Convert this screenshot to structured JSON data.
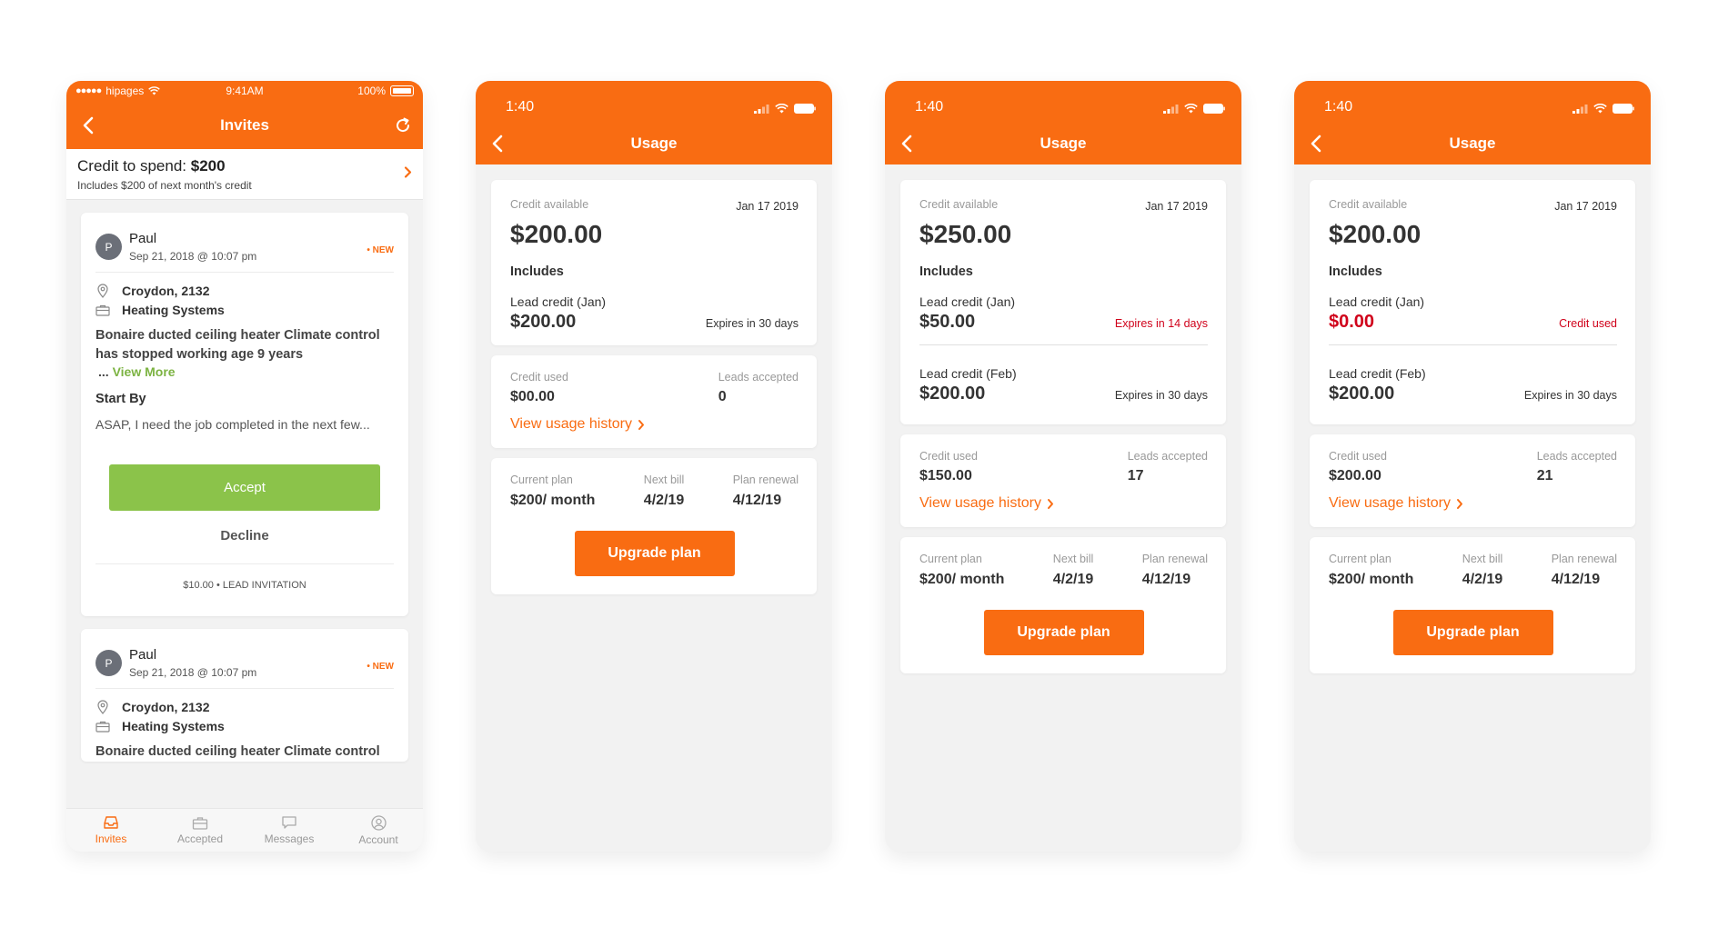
{
  "colors": {
    "accent": "#f96c12",
    "accept_green": "#8bc34a",
    "view_more_green": "#7cb342",
    "alert_red": "#d0021b"
  },
  "invites_screen": {
    "status": {
      "carrier": "hipages",
      "time": "9:41AM",
      "battery": "100%"
    },
    "title": "Invites",
    "credit": {
      "label": "Credit to spend:",
      "amount": "$200",
      "sub": "Includes $200 of next month's credit"
    },
    "cards": [
      {
        "avatar": "P",
        "name": "Paul",
        "date": "Sep 21, 2018 @ 10:07 pm",
        "badge": "• NEW",
        "location": "Croydon, 2132",
        "category": "Heating Systems",
        "description": "Bonaire ducted ceiling heater Climate control has stopped working age 9 years",
        "ellipsis": "... ",
        "view_more": "View More",
        "start_by_label": "Start By",
        "start_by_text": "ASAP, I need the job completed in the next few...",
        "accept": "Accept",
        "decline": "Decline",
        "footer": "$10.00 • LEAD INVITATION"
      },
      {
        "avatar": "P",
        "name": "Paul",
        "date": "Sep 21, 2018 @ 10:07 pm",
        "badge": "• NEW",
        "location": "Croydon, 2132",
        "category": "Heating Systems",
        "description": "Bonaire ducted ceiling heater Climate control"
      }
    ],
    "tabs": [
      {
        "label": "Invites",
        "icon": "inbox-icon"
      },
      {
        "label": "Accepted",
        "icon": "briefcase-icon"
      },
      {
        "label": "Messages",
        "icon": "chat-bubble-icon"
      },
      {
        "label": "Account",
        "icon": "user-circle-icon"
      }
    ]
  },
  "usage_screens": [
    {
      "time": "1:40",
      "title": "Usage",
      "credit_label": "Credit available",
      "date": "Jan 17 2019",
      "credit_amount": "$200.00",
      "includes_label": "Includes",
      "leads": [
        {
          "label": "Lead credit (Jan)",
          "amount": "$200.00",
          "expiry": "Expires in 30 days"
        }
      ],
      "credit_used_label": "Credit used",
      "credit_used": "$00.00",
      "leads_accepted_label": "Leads accepted",
      "leads_accepted": "0",
      "history_link": "View usage history",
      "plan": {
        "current_label": "Current plan",
        "current": "$200/ month",
        "next_bill_label": "Next bill",
        "next_bill": "4/2/19",
        "renewal_label": "Plan renewal",
        "renewal": "4/12/19"
      },
      "upgrade": "Upgrade plan"
    },
    {
      "time": "1:40",
      "title": "Usage",
      "credit_label": "Credit available",
      "date": "Jan 17 2019",
      "credit_amount": "$250.00",
      "includes_label": "Includes",
      "leads": [
        {
          "label": "Lead credit (Jan)",
          "amount": "$50.00",
          "expiry": "Expires in 14 days"
        },
        {
          "label": "Lead credit (Feb)",
          "amount": "$200.00",
          "expiry": "Expires in 30 days"
        }
      ],
      "credit_used_label": "Credit used",
      "credit_used": "$150.00",
      "leads_accepted_label": "Leads accepted",
      "leads_accepted": "17",
      "history_link": "View usage history",
      "plan": {
        "current_label": "Current plan",
        "current": "$200/ month",
        "next_bill_label": "Next bill",
        "next_bill": "4/2/19",
        "renewal_label": "Plan renewal",
        "renewal": "4/12/19"
      },
      "upgrade": "Upgrade plan"
    },
    {
      "time": "1:40",
      "title": "Usage",
      "credit_label": "Credit available",
      "date": "Jan 17 2019",
      "credit_amount": "$200.00",
      "includes_label": "Includes",
      "leads": [
        {
          "label": "Lead credit (Jan)",
          "amount": "$0.00",
          "expiry": "Credit used"
        },
        {
          "label": "Lead credit (Feb)",
          "amount": "$200.00",
          "expiry": "Expires in 30 days"
        }
      ],
      "credit_used_label": "Credit used",
      "credit_used": "$200.00",
      "leads_accepted_label": "Leads accepted",
      "leads_accepted": "21",
      "history_link": "View usage history",
      "plan": {
        "current_label": "Current plan",
        "current": "$200/ month",
        "next_bill_label": "Next bill",
        "next_bill": "4/2/19",
        "renewal_label": "Plan renewal",
        "renewal": "4/12/19"
      },
      "upgrade": "Upgrade plan"
    }
  ]
}
